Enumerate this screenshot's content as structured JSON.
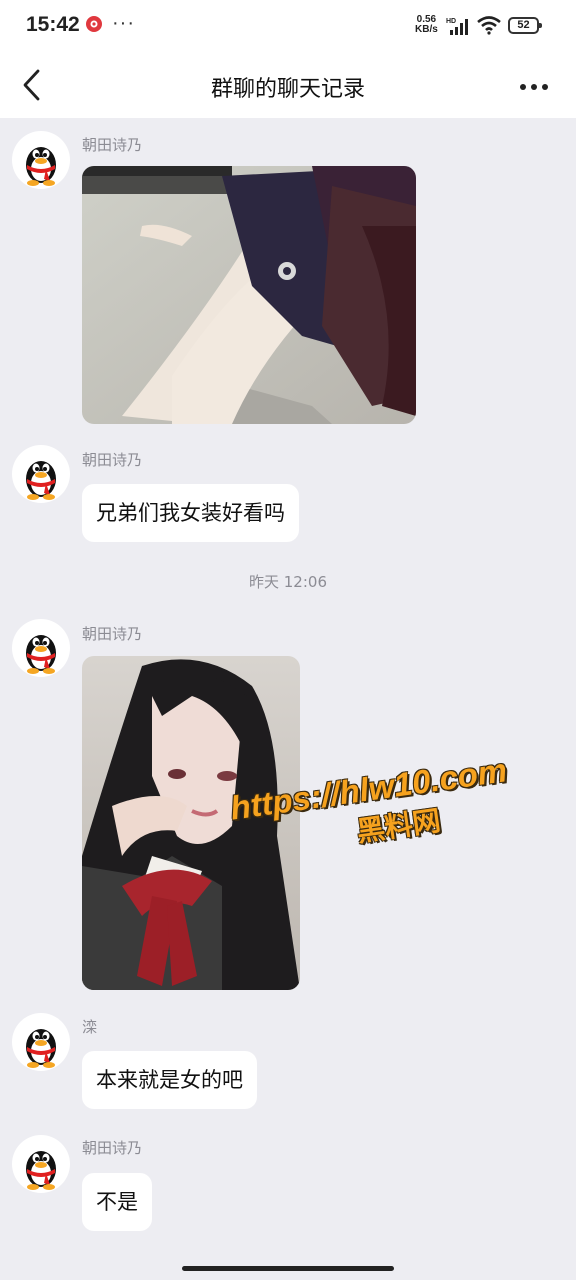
{
  "status_bar": {
    "time": "15:42",
    "dots": "···",
    "net_speed_value": "0.56",
    "net_speed_unit": "KB/s",
    "network_badge": "HD",
    "battery": "52",
    "app_icon": "red-flower-icon"
  },
  "nav": {
    "title": "群聊的聊天记录",
    "back_icon": "chevron-left-icon",
    "more_icon": "more-dots-icon"
  },
  "messages": [
    {
      "sender": "朝田诗乃",
      "type": "image",
      "image": "photo of person in dark costume lying on floor"
    },
    {
      "sender": "朝田诗乃",
      "type": "text",
      "text": "兄弟们我女装好看吗"
    },
    {
      "type": "timestamp",
      "text": "昨天 12:06"
    },
    {
      "sender": "朝田诗乃",
      "type": "image",
      "image": "selfie with long black hair and red bow"
    },
    {
      "sender": "滦",
      "type": "text",
      "text": "本来就是女的吧"
    },
    {
      "sender": "朝田诗乃",
      "type": "text",
      "text": "不是"
    }
  ],
  "watermark": {
    "line1": "https://hlw10.com",
    "line2": "黑料网"
  },
  "colors": {
    "background": "#ededf2",
    "bubble": "#ffffff",
    "watermark": "#f6a21e",
    "name_text": "#8c8c94"
  }
}
